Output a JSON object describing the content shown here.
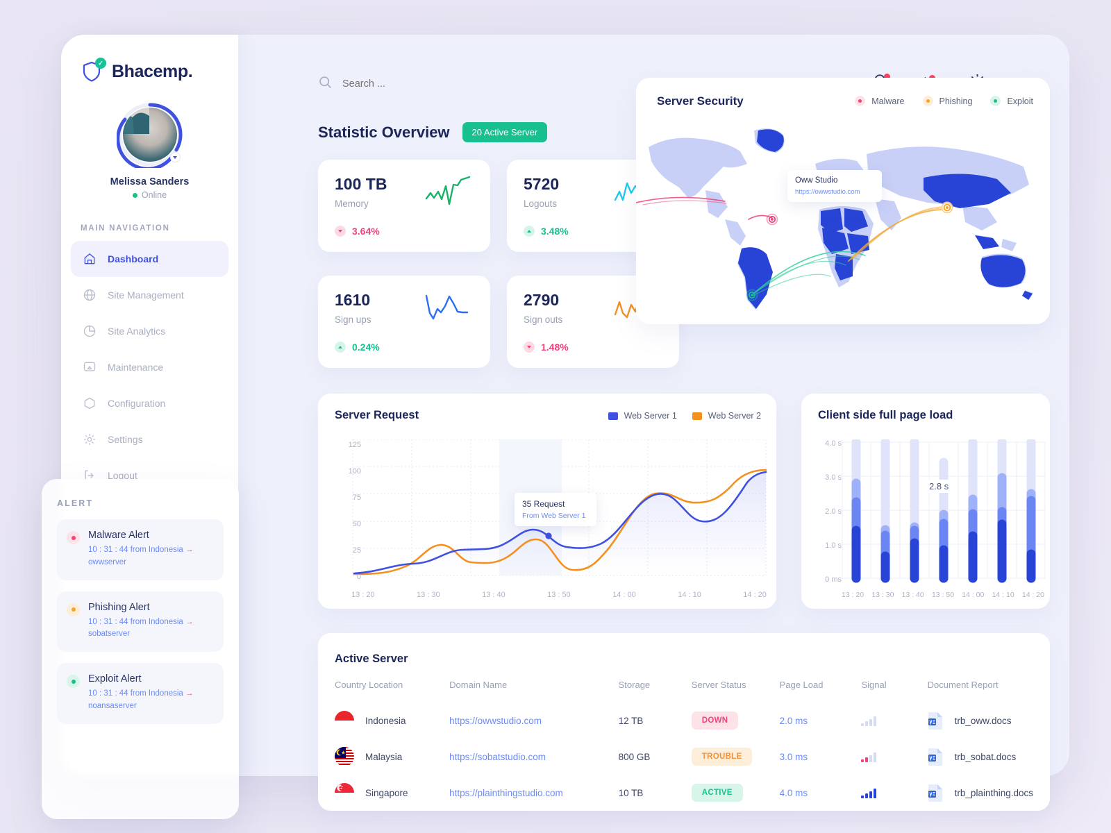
{
  "brand": {
    "name": "Bhacemp.",
    "logo_icon": "shield-check-icon"
  },
  "profile": {
    "name": "Melissa Sanders",
    "status": "Online"
  },
  "sidebar": {
    "nav_heading": "MAIN NAVIGATION",
    "items": [
      {
        "label": "Dashboard",
        "icon": "home-icon",
        "active": true
      },
      {
        "label": "Site Management",
        "icon": "globe-icon",
        "active": false
      },
      {
        "label": "Site Analytics",
        "icon": "pie-chart-icon",
        "active": false
      },
      {
        "label": "Maintenance",
        "icon": "monitor-icon",
        "active": false
      },
      {
        "label": "Configuration",
        "icon": "hexagon-icon",
        "active": false
      },
      {
        "label": "Settings",
        "icon": "gear-icon",
        "active": false
      },
      {
        "label": "Logout",
        "icon": "logout-icon",
        "active": false
      }
    ]
  },
  "alerts": {
    "heading": "ALERT",
    "items": [
      {
        "title": "Malware Alert",
        "meta": "10 : 31 : 44 from Indonesia",
        "arrow": "→",
        "server": "owwserver",
        "color": "#f0437a"
      },
      {
        "title": "Phishing Alert",
        "meta": "10 : 31 : 44 from Indonesia",
        "arrow": "→",
        "server": "sobatserver",
        "color": "#f5a623"
      },
      {
        "title": "Exploit Alert",
        "meta": "10 : 31 : 44 from Indonesia",
        "arrow": "→",
        "server": "noansaserver",
        "color": "#18c08f"
      }
    ]
  },
  "topbar": {
    "search_placeholder": "Search ...",
    "search_value": "",
    "icons": [
      {
        "name": "bell-icon",
        "has_dot": true
      },
      {
        "name": "activity-pulse-icon",
        "has_dot": true
      },
      {
        "name": "gear-icon",
        "has_dot": false
      }
    ]
  },
  "overview": {
    "title": "Statistic Overview",
    "badge": "20 Active Server",
    "cards": [
      {
        "value": "100 TB",
        "label": "Memory",
        "delta": "3.64%",
        "direction": "down",
        "spark_color": "#18b36b"
      },
      {
        "value": "5720",
        "label": "Logouts",
        "delta": "3.48%",
        "direction": "up",
        "spark_color": "#22c9ec"
      },
      {
        "value": "1610",
        "label": "Sign ups",
        "delta": "0.24%",
        "direction": "up",
        "spark_color": "#2d6ff0"
      },
      {
        "value": "2790",
        "label": "Sign outs",
        "delta": "1.48%",
        "direction": "down",
        "spark_color": "#f5901e"
      }
    ]
  },
  "map": {
    "title": "Server Security",
    "legend": [
      {
        "label": "Malware",
        "color": "#f0437a"
      },
      {
        "label": "Phishing",
        "color": "#f5a623"
      },
      {
        "label": "Exploit",
        "color": "#18c08f"
      }
    ],
    "tooltip": {
      "name": "Oww Studio",
      "url": "https://owwstudio.com"
    }
  },
  "chart_data": [
    {
      "type": "line",
      "title": "Server Request",
      "legend": [
        "Web Server 1",
        "Web Server 2"
      ],
      "legend_position": "top-right",
      "legend_colors": [
        "#3f51e0",
        "#f5901e"
      ],
      "x": [
        "13 : 20",
        "13 : 30",
        "13 : 40",
        "13 : 50",
        "14 : 00",
        "14 : 10",
        "14 : 20"
      ],
      "xlabel": "",
      "ylabel": "",
      "ylim": [
        0,
        125
      ],
      "yticks": [
        125,
        100,
        75,
        50,
        25,
        0
      ],
      "grid": true,
      "series": [
        {
          "name": "Web Server 1",
          "color": "#3f51e0",
          "values": [
            2,
            9,
            22,
            21,
            42,
            26,
            34,
            78,
            53,
            88
          ]
        },
        {
          "name": "Web Server 2",
          "color": "#f5901e",
          "values": [
            1,
            5,
            27,
            13,
            32,
            4,
            26,
            79,
            68,
            89
          ]
        }
      ],
      "annotation": {
        "value": "35 Request",
        "source": "From Web Server 1",
        "at_x": "13 : 50"
      }
    },
    {
      "type": "bar",
      "title": "Client side full page load",
      "categories": [
        "13 : 20",
        "13 : 30",
        "13 : 40",
        "13 : 50",
        "14 : 00",
        "14 : 10",
        "14 : 20"
      ],
      "xlabel": "",
      "ylabel": "",
      "ylim": [
        0,
        4.0
      ],
      "yticks": [
        "4.0 s",
        "3.0 s",
        "2.0 s",
        "1.0 s",
        "0 ms"
      ],
      "stacked": true,
      "track_max": 4.0,
      "grid": true,
      "annotation": "2.8 s",
      "series": [
        {
          "name": "dark",
          "color": "#2744d6",
          "values": [
            1.4,
            0.65,
            1.05,
            0.83,
            1.25,
            1.6,
            0.72
          ]
        },
        {
          "name": "mid",
          "color": "#4f6ef0",
          "values": [
            0.85,
            0.17,
            0.37,
            0.82,
            0.65,
            0.35,
            0.98
          ]
        },
        {
          "name": "light",
          "color": "#8fa4f6",
          "values": [
            0.45,
            0.6,
            0.08,
            0.2,
            0.45,
            0.95,
            0.75
          ]
        },
        {
          "name": "track",
          "color": "#dfe4fb",
          "values": [
            4.0,
            4.0,
            4.0,
            3.4,
            4.0,
            4.0,
            4.0
          ]
        }
      ]
    }
  ],
  "table": {
    "title": "Active Server",
    "columns": [
      "Country Location",
      "Domain Name",
      "Storage",
      "Server Status",
      "Page Load",
      "Signal",
      "Document Report"
    ],
    "rows": [
      {
        "country": "Indonesia",
        "domain": "https://owwstudio.com",
        "storage": "12 TB",
        "status": "DOWN",
        "status_style": "down",
        "page_load": "2.0 ms",
        "signal_level": 0,
        "signal_alert": true,
        "document": "trb_oww.docs",
        "flag": "flag-indonesia"
      },
      {
        "country": "Malaysia",
        "domain": "https://sobatstudio.com",
        "storage": "800 GB",
        "status": "TROUBLE",
        "status_style": "trouble",
        "page_load": "3.0 ms",
        "signal_level": 2,
        "signal_alert": false,
        "document": "trb_sobat.docs",
        "flag": "flag-malaysia"
      },
      {
        "country": "Singapore",
        "domain": "https://plainthingstudio.com",
        "storage": "10 TB",
        "status": "ACTIVE",
        "status_style": "active",
        "page_load": "4.0 ms",
        "signal_level": 4,
        "signal_alert": false,
        "document": "trb_plainthing.docs",
        "flag": "flag-singapore"
      }
    ]
  },
  "colors": {
    "accent": "#3f51e0",
    "green": "#18c08f",
    "orange": "#f5901e",
    "pink": "#f0437a",
    "page_bg": "#e9e5f4",
    "app_bg": "#eef0fb",
    "card_bg": "#ffffff",
    "text_dark": "#1b2559",
    "text_muted": "#9aa0b5"
  }
}
